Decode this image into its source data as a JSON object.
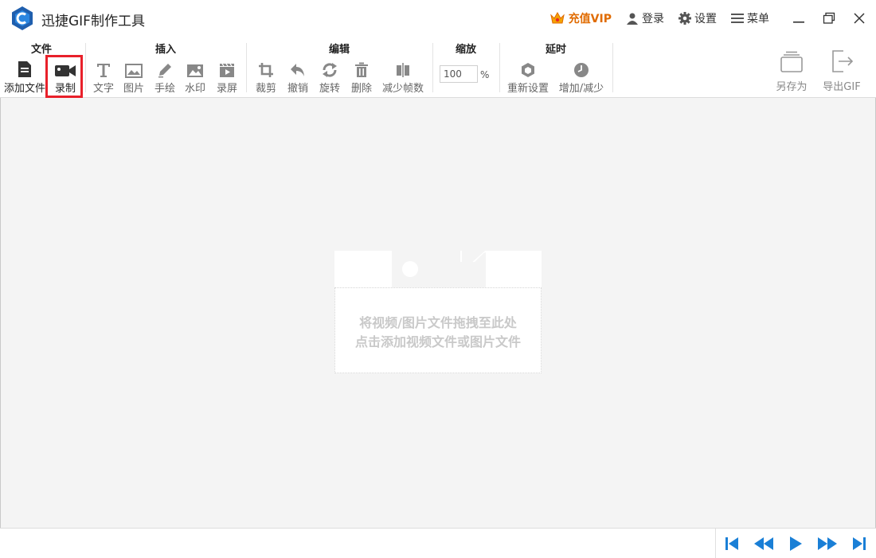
{
  "app": {
    "title": "迅捷GIF制作工具"
  },
  "titlebar": {
    "vip_label": "充值VIP",
    "login_label": "登录",
    "settings_label": "设置",
    "menu_label": "菜单"
  },
  "ribbon": {
    "groups": {
      "file": "文件",
      "insert": "插入",
      "edit": "编辑",
      "zoom": "缩放",
      "delay": "延时"
    },
    "tools": {
      "add_file": "添加文件",
      "record": "录制",
      "text": "文字",
      "image": "图片",
      "draw": "手绘",
      "watermark": "水印",
      "screen_record": "录屏",
      "crop": "裁剪",
      "undo": "撤销",
      "rotate": "旋转",
      "delete": "删除",
      "reduce_frames": "减少帧数",
      "reset": "重新设置",
      "adjust": "增加/减少",
      "save_as": "另存为",
      "export_gif": "导出GIF"
    },
    "zoom_value": "100",
    "zoom_unit": "%"
  },
  "drop_area": {
    "line1": "将视频/图片文件拖拽至此处",
    "line2": "点击添加视频文件或图片文件"
  },
  "colors": {
    "accent_blue": "#1a7fd6",
    "highlight_red": "#e8202a",
    "vip_orange": "#e06b00"
  }
}
